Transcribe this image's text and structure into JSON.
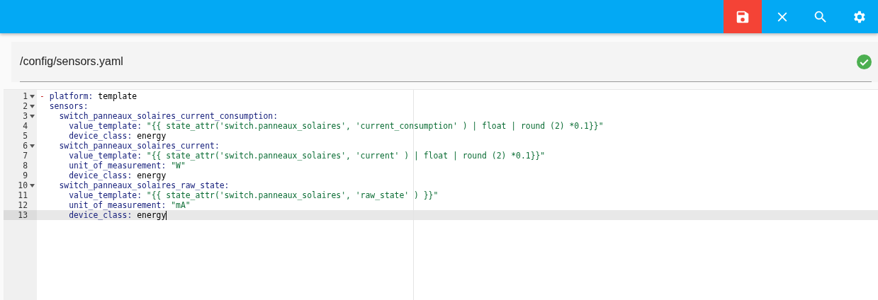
{
  "toolbar": {
    "buttons": [
      {
        "kind": "save",
        "highlighted": true
      },
      {
        "kind": "close",
        "highlighted": false
      },
      {
        "kind": "search",
        "highlighted": false
      },
      {
        "kind": "settings",
        "highlighted": false
      }
    ]
  },
  "file": {
    "path": "/config/sensors.yaml",
    "valid": true
  },
  "editor": {
    "lines": [
      {
        "number": "1",
        "foldable": true,
        "active": false,
        "tokens": [
          {
            "kind": "dash",
            "text": "- "
          },
          {
            "kind": "key",
            "text": "platform:"
          },
          {
            "kind": "plain",
            "text": " template"
          }
        ]
      },
      {
        "number": "2",
        "foldable": true,
        "active": false,
        "tokens": [
          {
            "kind": "key",
            "text": "  sensors:"
          }
        ]
      },
      {
        "number": "3",
        "foldable": true,
        "active": false,
        "tokens": [
          {
            "kind": "key",
            "text": "    switch_panneaux_solaires_current_consumption:"
          }
        ]
      },
      {
        "number": "4",
        "foldable": false,
        "active": false,
        "tokens": [
          {
            "kind": "key",
            "text": "      value_template:"
          },
          {
            "kind": "string",
            "text": " \"{{ state_attr('switch.panneaux_solaires', 'current_consumption' ) | float | round (2) *0.1}}\""
          }
        ]
      },
      {
        "number": "5",
        "foldable": false,
        "active": false,
        "tokens": [
          {
            "kind": "key",
            "text": "      device_class:"
          },
          {
            "kind": "plain",
            "text": " energy"
          }
        ]
      },
      {
        "number": "6",
        "foldable": true,
        "active": false,
        "tokens": [
          {
            "kind": "key",
            "text": "    switch_panneaux_solaires_current:"
          }
        ]
      },
      {
        "number": "7",
        "foldable": false,
        "active": false,
        "tokens": [
          {
            "kind": "key",
            "text": "      value_template:"
          },
          {
            "kind": "string",
            "text": " \"{{ state_attr('switch.panneaux_solaires', 'current' ) | float | round (2) *0.1}}\""
          }
        ]
      },
      {
        "number": "8",
        "foldable": false,
        "active": false,
        "tokens": [
          {
            "kind": "key",
            "text": "      unit_of_measurement:"
          },
          {
            "kind": "string",
            "text": " \"W\""
          }
        ]
      },
      {
        "number": "9",
        "foldable": false,
        "active": false,
        "tokens": [
          {
            "kind": "key",
            "text": "      device_class:"
          },
          {
            "kind": "plain",
            "text": " energy"
          }
        ]
      },
      {
        "number": "10",
        "foldable": true,
        "active": false,
        "tokens": [
          {
            "kind": "key",
            "text": "    switch_panneaux_solaires_raw_state:"
          }
        ]
      },
      {
        "number": "11",
        "foldable": false,
        "active": false,
        "tokens": [
          {
            "kind": "key",
            "text": "      value_template:"
          },
          {
            "kind": "string",
            "text": " \"{{ state_attr('switch.panneaux_solaires', 'raw_state' ) }}\""
          }
        ]
      },
      {
        "number": "12",
        "foldable": false,
        "active": false,
        "tokens": [
          {
            "kind": "key",
            "text": "      unit_of_measurement:"
          },
          {
            "kind": "string",
            "text": " \"mA\""
          }
        ]
      },
      {
        "number": "13",
        "foldable": false,
        "active": true,
        "tokens": [
          {
            "kind": "key",
            "text": "      device_class:"
          },
          {
            "kind": "plain",
            "text": " energy"
          }
        ]
      }
    ]
  }
}
